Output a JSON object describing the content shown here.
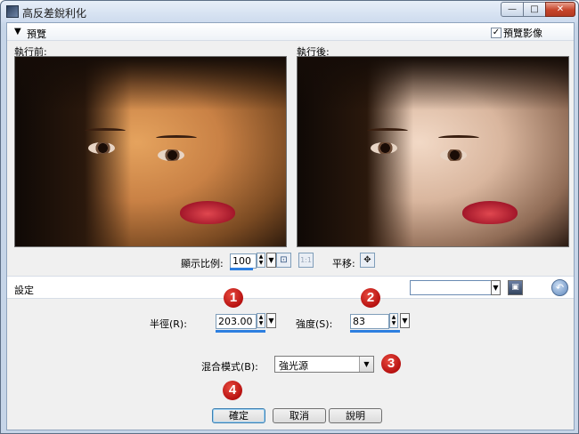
{
  "window": {
    "title": "高反差銳利化",
    "minimize_glyph": "—",
    "maximize_glyph": "□",
    "close_glyph": "✕"
  },
  "preview": {
    "header_label": "預覽",
    "collapse_glyph": "▼",
    "show_preview_checkbox": {
      "label": "預覽影像",
      "checked": true,
      "glyph": "✓"
    },
    "before_label": "執行前:",
    "after_label": "執行後:",
    "zoom": {
      "label": "顯示比例:",
      "value": "100"
    },
    "fit_icon": "fit-to-window-icon",
    "actual_size_label": "1:1",
    "pan": {
      "label": "平移:",
      "glyph": "✥"
    }
  },
  "settings": {
    "label": "設定",
    "preset_value": "",
    "save_glyph": "▣",
    "reset_glyph": "↶"
  },
  "fields": {
    "radius": {
      "label": "半徑(R):",
      "value": "203.00",
      "badge": "1"
    },
    "strength": {
      "label": "強度(S):",
      "value": "83",
      "badge": "2"
    },
    "blend": {
      "label": "混合模式(B):",
      "value": "強光源",
      "badge": "3"
    },
    "step4_badge": "4"
  },
  "buttons": {
    "ok": "確定",
    "cancel": "取消",
    "help": "說明"
  },
  "glyphs": {
    "spin_up": "▲",
    "spin_down": "▼",
    "drop": "▼"
  },
  "colors": {
    "accent_underline": "#2d7fe0",
    "badge_red": "#c41a16",
    "close_button": "#c6452b"
  }
}
